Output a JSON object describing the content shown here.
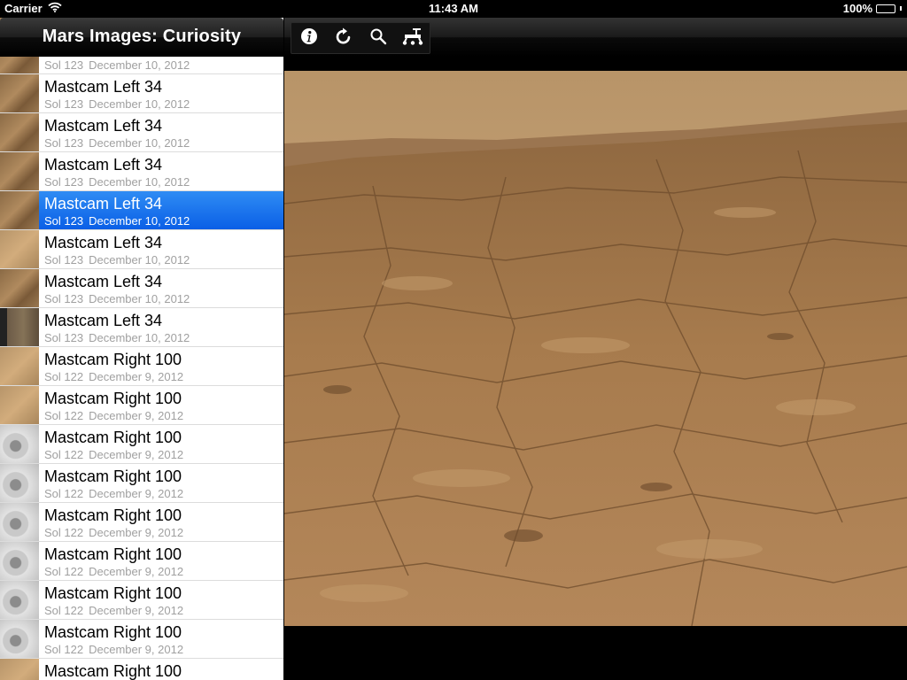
{
  "status_bar": {
    "carrier": "Carrier",
    "time": "11:43 AM",
    "battery": "100%",
    "battery_level": 1.0
  },
  "app": {
    "title": "Mars Images: Curiosity"
  },
  "images": [
    {
      "title": "Mastcam Left 34",
      "sol": "Sol 123",
      "date": "December 10, 2012",
      "thumb": "t-brown",
      "selected": false
    },
    {
      "title": "Mastcam Left 34",
      "sol": "Sol 123",
      "date": "December 10, 2012",
      "thumb": "t-brown",
      "selected": false
    },
    {
      "title": "Mastcam Left 34",
      "sol": "Sol 123",
      "date": "December 10, 2012",
      "thumb": "t-brown",
      "selected": false
    },
    {
      "title": "Mastcam Left 34",
      "sol": "Sol 123",
      "date": "December 10, 2012",
      "thumb": "t-brown",
      "selected": false
    },
    {
      "title": "Mastcam Left 34",
      "sol": "Sol 123",
      "date": "December 10, 2012",
      "thumb": "t-brown",
      "selected": false
    },
    {
      "title": "Mastcam Left 34",
      "sol": "Sol 123",
      "date": "December 10, 2012",
      "thumb": "t-brown",
      "selected": true
    },
    {
      "title": "Mastcam Left 34",
      "sol": "Sol 123",
      "date": "December 10, 2012",
      "thumb": "t-light",
      "selected": false
    },
    {
      "title": "Mastcam Left 34",
      "sol": "Sol 123",
      "date": "December 10, 2012",
      "thumb": "t-brown",
      "selected": false
    },
    {
      "title": "Mastcam Left 34",
      "sol": "Sol 123",
      "date": "December 10, 2012",
      "thumb": "t-dark",
      "selected": false
    },
    {
      "title": "Mastcam Right 100",
      "sol": "Sol 122",
      "date": "December 9, 2012",
      "thumb": "t-light",
      "selected": false
    },
    {
      "title": "Mastcam Right 100",
      "sol": "Sol 122",
      "date": "December 9, 2012",
      "thumb": "t-light",
      "selected": false
    },
    {
      "title": "Mastcam Right 100",
      "sol": "Sol 122",
      "date": "December 9, 2012",
      "thumb": "t-gray",
      "selected": false
    },
    {
      "title": "Mastcam Right 100",
      "sol": "Sol 122",
      "date": "December 9, 2012",
      "thumb": "t-gray",
      "selected": false
    },
    {
      "title": "Mastcam Right 100",
      "sol": "Sol 122",
      "date": "December 9, 2012",
      "thumb": "t-gray",
      "selected": false
    },
    {
      "title": "Mastcam Right 100",
      "sol": "Sol 122",
      "date": "December 9, 2012",
      "thumb": "t-gray",
      "selected": false
    },
    {
      "title": "Mastcam Right 100",
      "sol": "Sol 122",
      "date": "December 9, 2012",
      "thumb": "t-gray",
      "selected": false
    },
    {
      "title": "Mastcam Right 100",
      "sol": "Sol 122",
      "date": "December 9, 2012",
      "thumb": "t-gray",
      "selected": false
    },
    {
      "title": "Mastcam Right 100",
      "sol": "Sol 122",
      "date": "December 9, 2012",
      "thumb": "t-light",
      "selected": false
    }
  ],
  "toolbar": {
    "icons": [
      "info-icon",
      "refresh-icon",
      "search-icon",
      "rover-icon"
    ]
  },
  "colors": {
    "selection": "#0a62e6",
    "sky": "#c9a67a",
    "terrain": "#a07448"
  }
}
